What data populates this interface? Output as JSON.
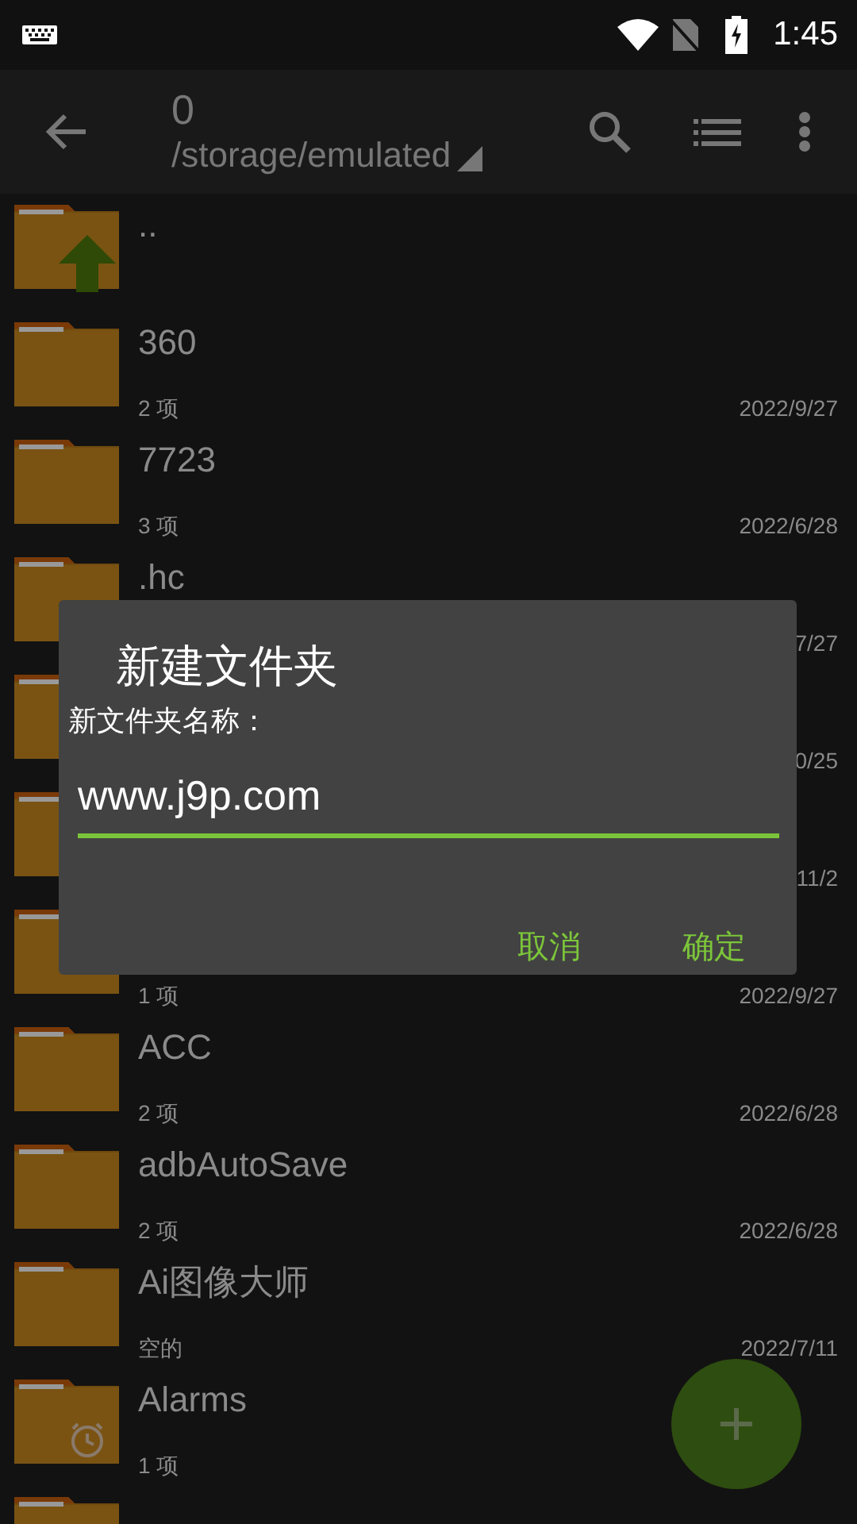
{
  "status_bar": {
    "time": "1:45"
  },
  "toolbar": {
    "title": "0",
    "path": "/storage/emulated"
  },
  "rows": [
    {
      "kind": "up",
      "name": ".."
    },
    {
      "kind": "folder",
      "name": "360",
      "meta": "2 项",
      "date": "2022/9/27"
    },
    {
      "kind": "folder",
      "name": "7723",
      "meta": "3 项",
      "date": "2022/6/28"
    },
    {
      "kind": "folder",
      "name": ".hc",
      "date": "7/27"
    },
    {
      "kind": "folder",
      "date": "0/25"
    },
    {
      "kind": "folder",
      "date": "11/2"
    },
    {
      "kind": "folder",
      "meta": "1 项",
      "date": "2022/9/27"
    },
    {
      "kind": "folder",
      "name": "ACC",
      "meta": "2 项",
      "date": "2022/6/28"
    },
    {
      "kind": "folder",
      "name": "adbAutoSave",
      "meta": "2 项",
      "date": "2022/6/28"
    },
    {
      "kind": "folder",
      "name": "Ai图像大师",
      "meta": "空的",
      "date": "2022/7/11"
    },
    {
      "kind": "alarm",
      "name": "Alarms",
      "meta": "1 项"
    },
    {
      "kind": "folder"
    }
  ],
  "dialog": {
    "title": "新建文件夹",
    "label": "新文件夹名称：",
    "value": "www.j9p.com",
    "buttons": [
      "取消",
      "确定"
    ]
  }
}
